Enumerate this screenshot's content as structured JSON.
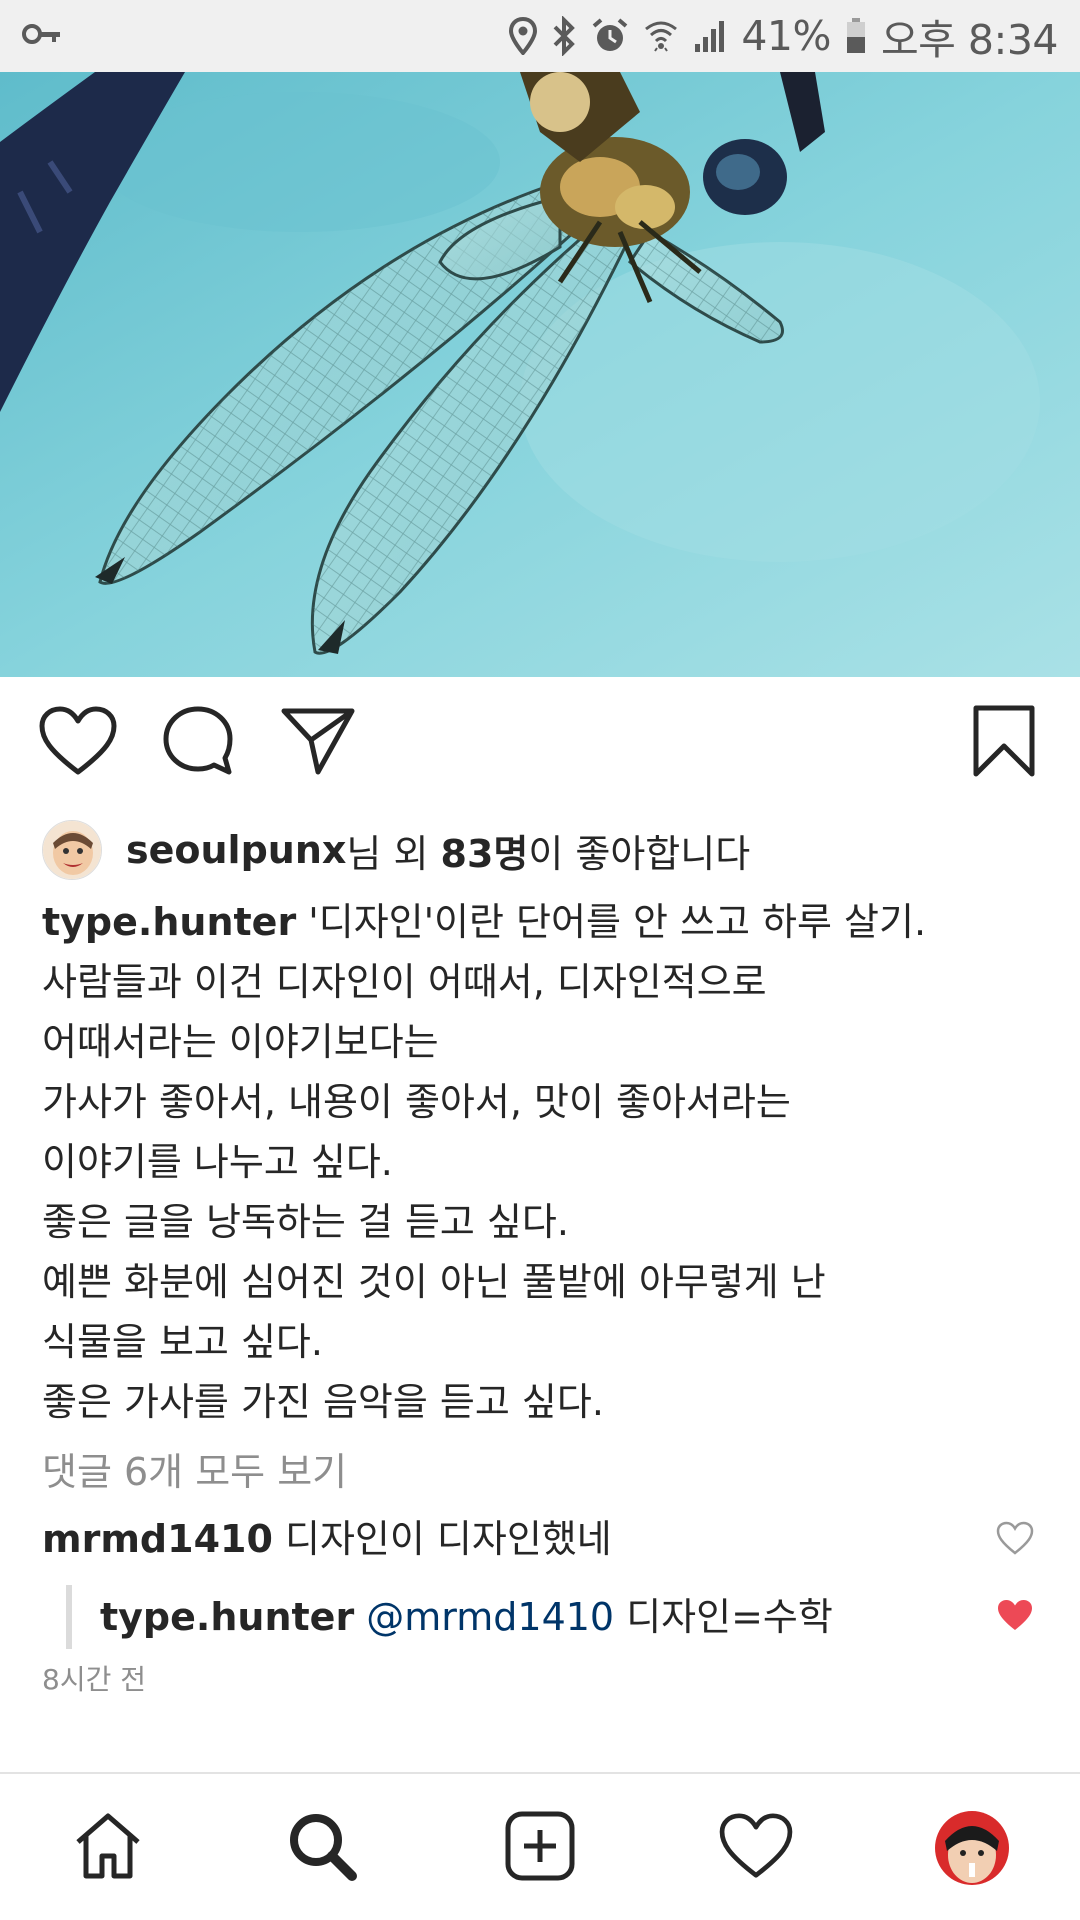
{
  "status_bar": {
    "battery_percent": "41%",
    "clock": "오후 8:34",
    "icons": [
      "key-icon",
      "location-icon",
      "bluetooth-icon",
      "alarm-icon",
      "wifi-icon",
      "signal-icon",
      "battery-icon"
    ]
  },
  "post": {
    "likes": {
      "liker": "seoulpunx",
      "mid": "님 외 ",
      "count": "83명",
      "suffix": "이 좋아합니다"
    },
    "caption": {
      "author": "type.hunter",
      "first_line": "'디자인'이란 단어를 안 쓰고 하루 살기.",
      "lines": [
        "사람들과 이건 디자인이 어때서, 디자인적으로",
        "어때서라는 이야기보다는",
        "가사가 좋아서, 내용이 좋아서, 맛이 좋아서라는",
        "이야기를 나누고 싶다.",
        "좋은 글을 낭독하는 걸 듣고 싶다.",
        "예쁜 화분에 심어진 것이 아닌 풀밭에 아무렇게 난",
        "식물을 보고 싶다.",
        "좋은 가사를 가진 음악을 듣고 싶다."
      ]
    },
    "view_all_comments": "댓글 6개 모두 보기",
    "comments": [
      {
        "user": "mrmd1410",
        "text": "디자인이 디자인했네",
        "liked": false
      }
    ],
    "reply": {
      "user": "type.hunter",
      "mention": "@mrmd1410",
      "text": "디자인=수학",
      "liked": true
    },
    "timestamp": "8시간 전"
  },
  "colors": {
    "accent_heart": "#ed4956",
    "mention": "#003569",
    "muted": "#8e8e8e",
    "water": "#7ecfd8"
  }
}
